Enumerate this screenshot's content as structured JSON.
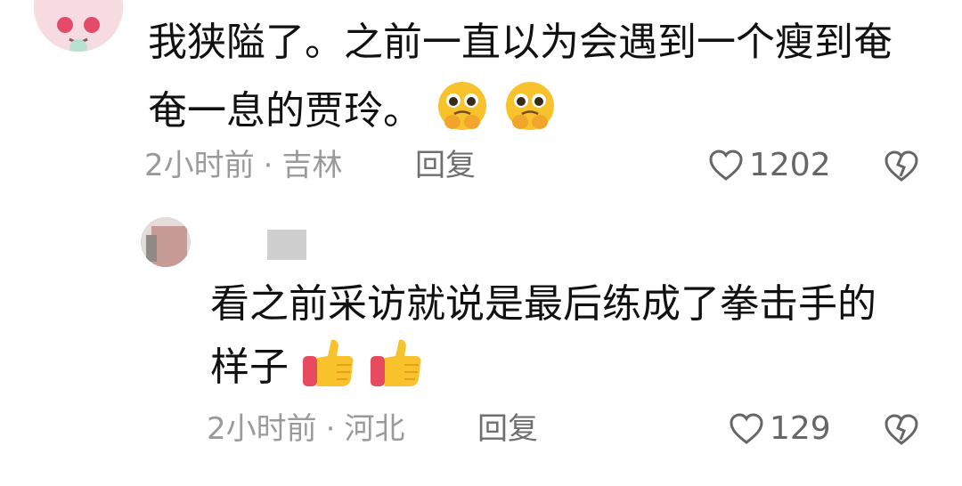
{
  "comments": [
    {
      "text_line1": "我狭隘了。之前一直以为会遇到一个瘦到奄",
      "text_line2": "奄一息的贾玲。",
      "time": "2小时前",
      "location": "吉林",
      "reply_label": "回复",
      "likes": "1202",
      "emojis": [
        "pleading-face-icon",
        "pleading-face-icon"
      ]
    },
    {
      "username": "",
      "text_line1": "看之前采访就说是最后练成了拳击手的",
      "text_line2": "样子",
      "time": "2小时前",
      "location": "河北",
      "reply_label": "回复",
      "likes": "129",
      "emojis": [
        "thumbs-up-icon",
        "thumbs-up-icon"
      ]
    }
  ],
  "separator": "·",
  "colors": {
    "meta": "#9a9a9a",
    "text": "#111111",
    "emoji_yellow": "#f7c22b",
    "cuff_red": "#e84a5f"
  }
}
